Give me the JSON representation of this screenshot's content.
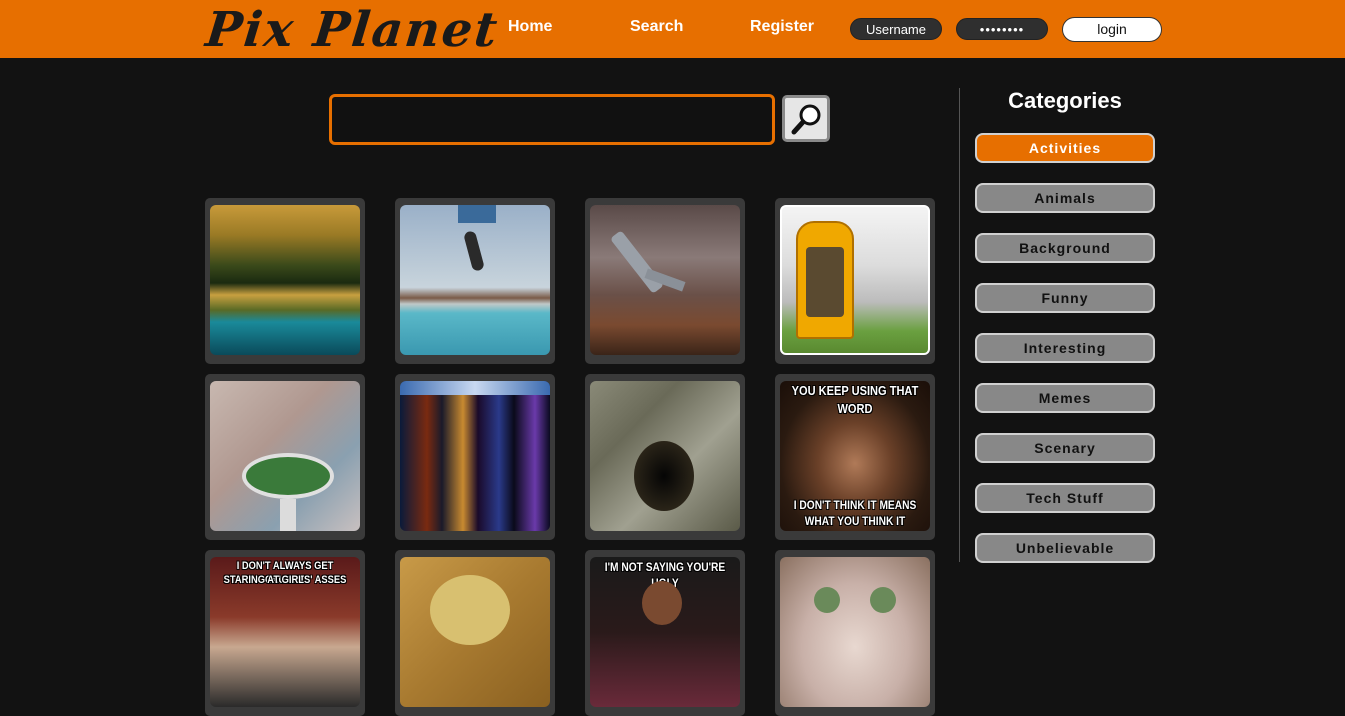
{
  "header": {
    "logo": "Pix Planet",
    "nav": {
      "home": "Home",
      "search": "Search",
      "register": "Register"
    },
    "username_field": "Username",
    "password_field": "••••••••",
    "login_label": "login"
  },
  "search": {
    "value": ""
  },
  "gallery": {
    "memes": {
      "inigo_top_1": "YOU KEEP USING THAT",
      "inigo_top_2": "WORD",
      "inigo_bottom_1": "I DON'T THINK IT MEANS",
      "inigo_bottom_2": "WHAT YOU THINK IT MEANS",
      "interesting_man_1": "I DON'T ALWAYS GET CAUGHT",
      "interesting_man_2": "STARING AT GIRLS' ASSES",
      "chappelle": "I'M NOT SAYING YOU'RE UGLY"
    }
  },
  "sidebar": {
    "title": "Categories",
    "categories": [
      "Activities",
      "Animals",
      "Background",
      "Funny",
      "Interesting",
      "Memes",
      "Scenary",
      "Tech Stuff",
      "Unbelievable"
    ]
  },
  "colors": {
    "accent": "#e76f00",
    "background": "#121212",
    "tile": "#3a3a3a"
  }
}
